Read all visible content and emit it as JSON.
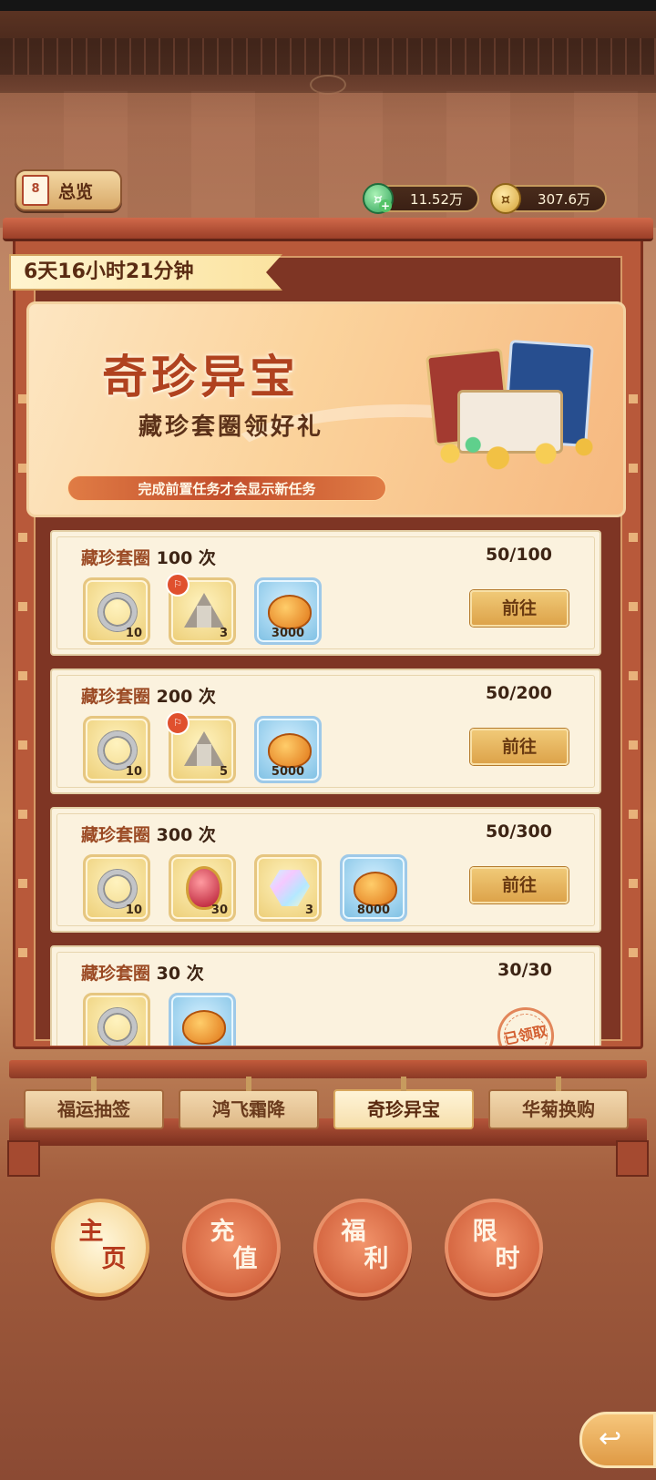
{
  "header": {
    "overview_label": "总览",
    "calendar_day": "8"
  },
  "currencies": [
    {
      "icon": "jade-coin-icon",
      "value": "11.52万"
    },
    {
      "icon": "gold-coin-icon",
      "value": "307.6万"
    }
  ],
  "timer": "6天16小时21分钟",
  "banner": {
    "title": "奇珍异宝",
    "subtitle": "藏珍套圈领好礼",
    "notice": "完成前置任务才会显示新任务"
  },
  "tasks": [
    {
      "prefix": "藏珍套圈",
      "count": "100 次",
      "progress": "50/100",
      "rewards": [
        {
          "icon": "silver-ring-icon",
          "qty": "10"
        },
        {
          "icon": "tent-icon",
          "qty": "3",
          "tag": "⚐"
        },
        {
          "icon": "amber-stone-icon",
          "qty": "3000"
        }
      ],
      "action": "前往"
    },
    {
      "prefix": "藏珍套圈",
      "count": "200 次",
      "progress": "50/200",
      "rewards": [
        {
          "icon": "silver-ring-icon",
          "qty": "10"
        },
        {
          "icon": "tent-icon",
          "qty": "5",
          "tag": "⚐"
        },
        {
          "icon": "amber-stone-icon",
          "qty": "5000"
        }
      ],
      "action": "前往"
    },
    {
      "prefix": "藏珍套圈",
      "count": "300 次",
      "progress": "50/300",
      "rewards": [
        {
          "icon": "silver-ring-icon",
          "qty": "10"
        },
        {
          "icon": "red-gem-icon",
          "qty": "30"
        },
        {
          "icon": "crystal-icon",
          "qty": "3"
        },
        {
          "icon": "amber-stone-icon",
          "qty": "8000"
        }
      ],
      "action": "前往"
    },
    {
      "prefix": "藏珍套圈",
      "count": "30 次",
      "progress": "30/30",
      "rewards": [
        {
          "icon": "silver-ring-icon",
          "qty": ""
        },
        {
          "icon": "amber-stone-icon",
          "qty": ""
        }
      ],
      "claimed": "已领取"
    }
  ],
  "tabs": [
    "福运抽签",
    "鸿飞霜降",
    "奇珍异宝",
    "华菊换购"
  ],
  "active_tab": 2,
  "bottom_nav": [
    {
      "line1": "主",
      "line2": "页"
    },
    {
      "line1": "充",
      "line2": "值"
    },
    {
      "line1": "福",
      "line2": "利"
    },
    {
      "line1": "限",
      "line2": "时"
    }
  ],
  "back_icon": "back-arrow-icon"
}
